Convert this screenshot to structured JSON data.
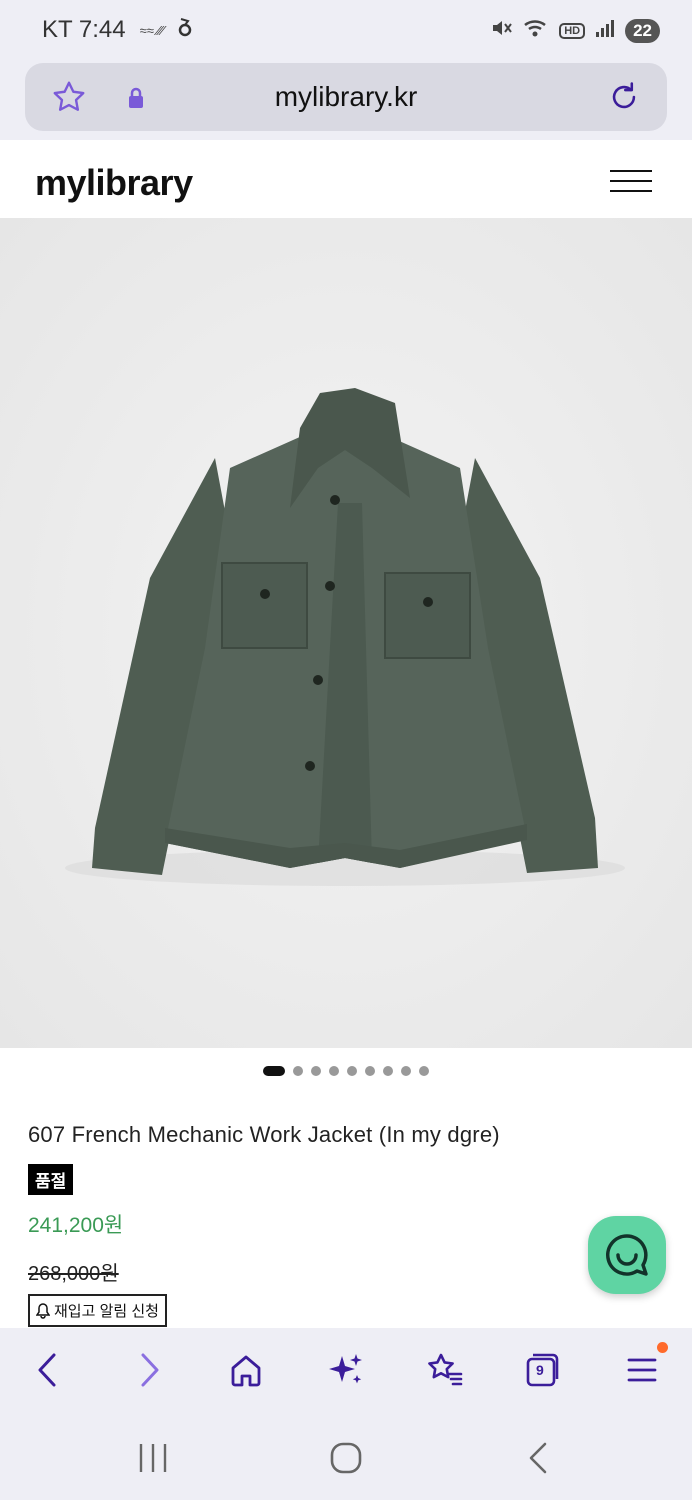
{
  "status_bar": {
    "carrier": "KT",
    "time": "7:44",
    "notif_icons": "≈≈ ∕∕∕",
    "battery": "22",
    "hd_label": "HD"
  },
  "address_bar": {
    "url": "mylibrary.kr"
  },
  "site": {
    "logo": "mylibrary"
  },
  "gallery": {
    "total_slides": 9,
    "active_index": 0
  },
  "product": {
    "title": "607 French Mechanic Work Jacket (In my dgre)",
    "soldout_label": "품절",
    "sale_price": "241,200원",
    "original_price": "268,000원",
    "restock_label": "재입고 알림 신청"
  },
  "browser_toolbar": {
    "tab_count": "9"
  },
  "colors": {
    "accent": "#3b1d9a",
    "price_green": "#3a9a55",
    "chat_green": "#5fd4a3",
    "notification_dot": "#ff6a2b"
  }
}
